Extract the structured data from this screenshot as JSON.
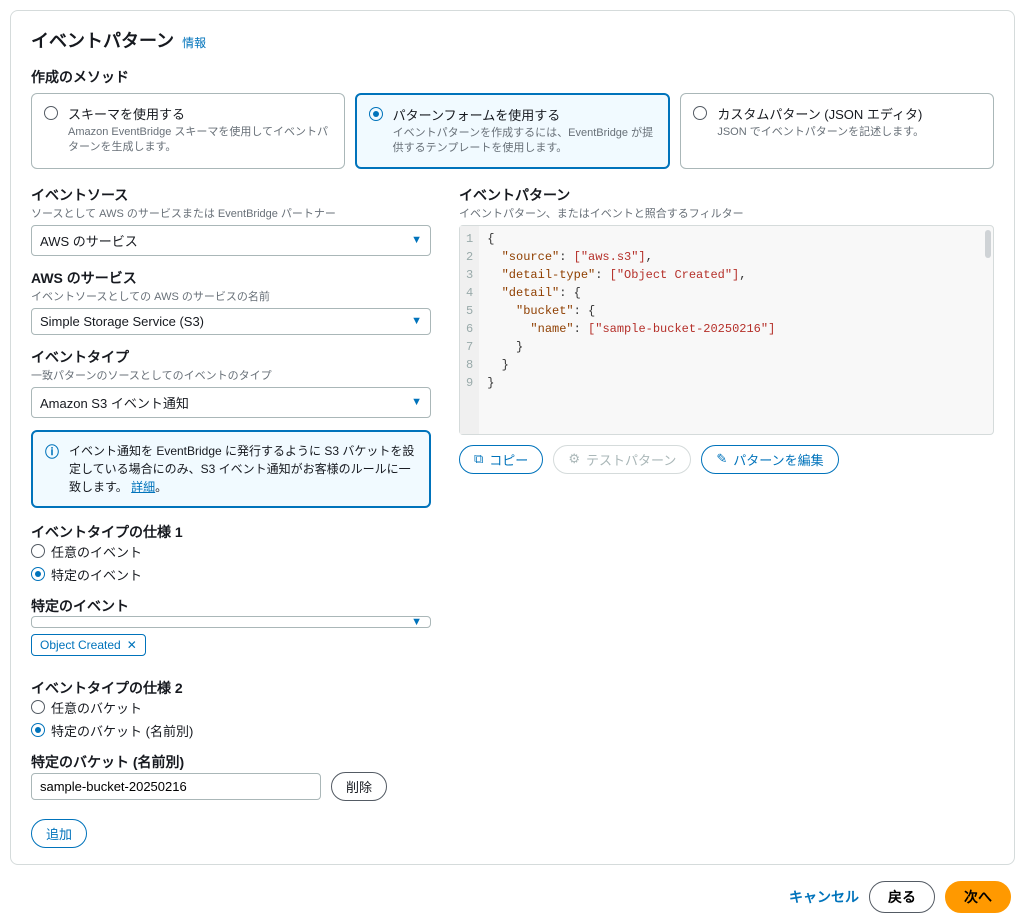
{
  "header": {
    "title": "イベントパターン",
    "info": "情報"
  },
  "method": {
    "label": "作成のメソッド",
    "tiles": [
      {
        "title": "スキーマを使用する",
        "desc": "Amazon EventBridge スキーマを使用してイベントパターンを生成します。",
        "selected": false
      },
      {
        "title": "パターンフォームを使用する",
        "desc": "イベントパターンを作成するには、EventBridge が提供するテンプレートを使用します。",
        "selected": true
      },
      {
        "title": "カスタムパターン (JSON エディタ)",
        "desc": "JSON でイベントパターンを記述します。",
        "selected": false
      }
    ]
  },
  "left": {
    "eventSource": {
      "label": "イベントソース",
      "hint": "ソースとして AWS のサービスまたは EventBridge パートナー",
      "value": "AWS のサービス"
    },
    "awsService": {
      "label": "AWS のサービス",
      "hint": "イベントソースとしての AWS のサービスの名前",
      "value": "Simple Storage Service (S3)"
    },
    "eventType": {
      "label": "イベントタイプ",
      "hint": "一致パターンのソースとしてのイベントのタイプ",
      "value": "Amazon S3 イベント通知"
    },
    "alert": {
      "text": "イベント通知を EventBridge に発行するように S3 バケットを設定している場合にのみ、S3 イベント通知がお客様のルールに一致します。",
      "link": "詳細"
    },
    "spec1": {
      "label": "イベントタイプの仕様 1",
      "options": [
        {
          "label": "任意のイベント",
          "checked": false
        },
        {
          "label": "特定のイベント",
          "checked": true
        }
      ],
      "specificLabel": "特定のイベント",
      "token": "Object Created"
    },
    "spec2": {
      "label": "イベントタイプの仕様 2",
      "options": [
        {
          "label": "任意のバケット",
          "checked": false
        },
        {
          "label": "特定のバケット (名前別)",
          "checked": true
        }
      ],
      "specificLabel": "特定のバケット (名前別)",
      "value": "sample-bucket-20250216",
      "remove": "削除"
    },
    "add": "追加"
  },
  "right": {
    "label": "イベントパターン",
    "hint": "イベントパターン、またはイベントと照合するフィルター",
    "code": {
      "lines": [
        "1",
        "2",
        "3",
        "4",
        "5",
        "6",
        "7",
        "8",
        "9"
      ],
      "l1": "{",
      "l2_key": "\"source\"",
      "l2_val": "[\"aws.s3\"]",
      "l3_key": "\"detail-type\"",
      "l3_val": "[\"Object Created\"]",
      "l4_key": "\"detail\"",
      "l5_key": "\"bucket\"",
      "l6_key": "\"name\"",
      "l6_val": "[\"sample-bucket-20250216\"]"
    },
    "actions": {
      "copy": "コピー",
      "test": "テストパターン",
      "edit": "パターンを編集"
    }
  },
  "footer": {
    "cancel": "キャンセル",
    "back": "戻る",
    "next": "次へ"
  }
}
